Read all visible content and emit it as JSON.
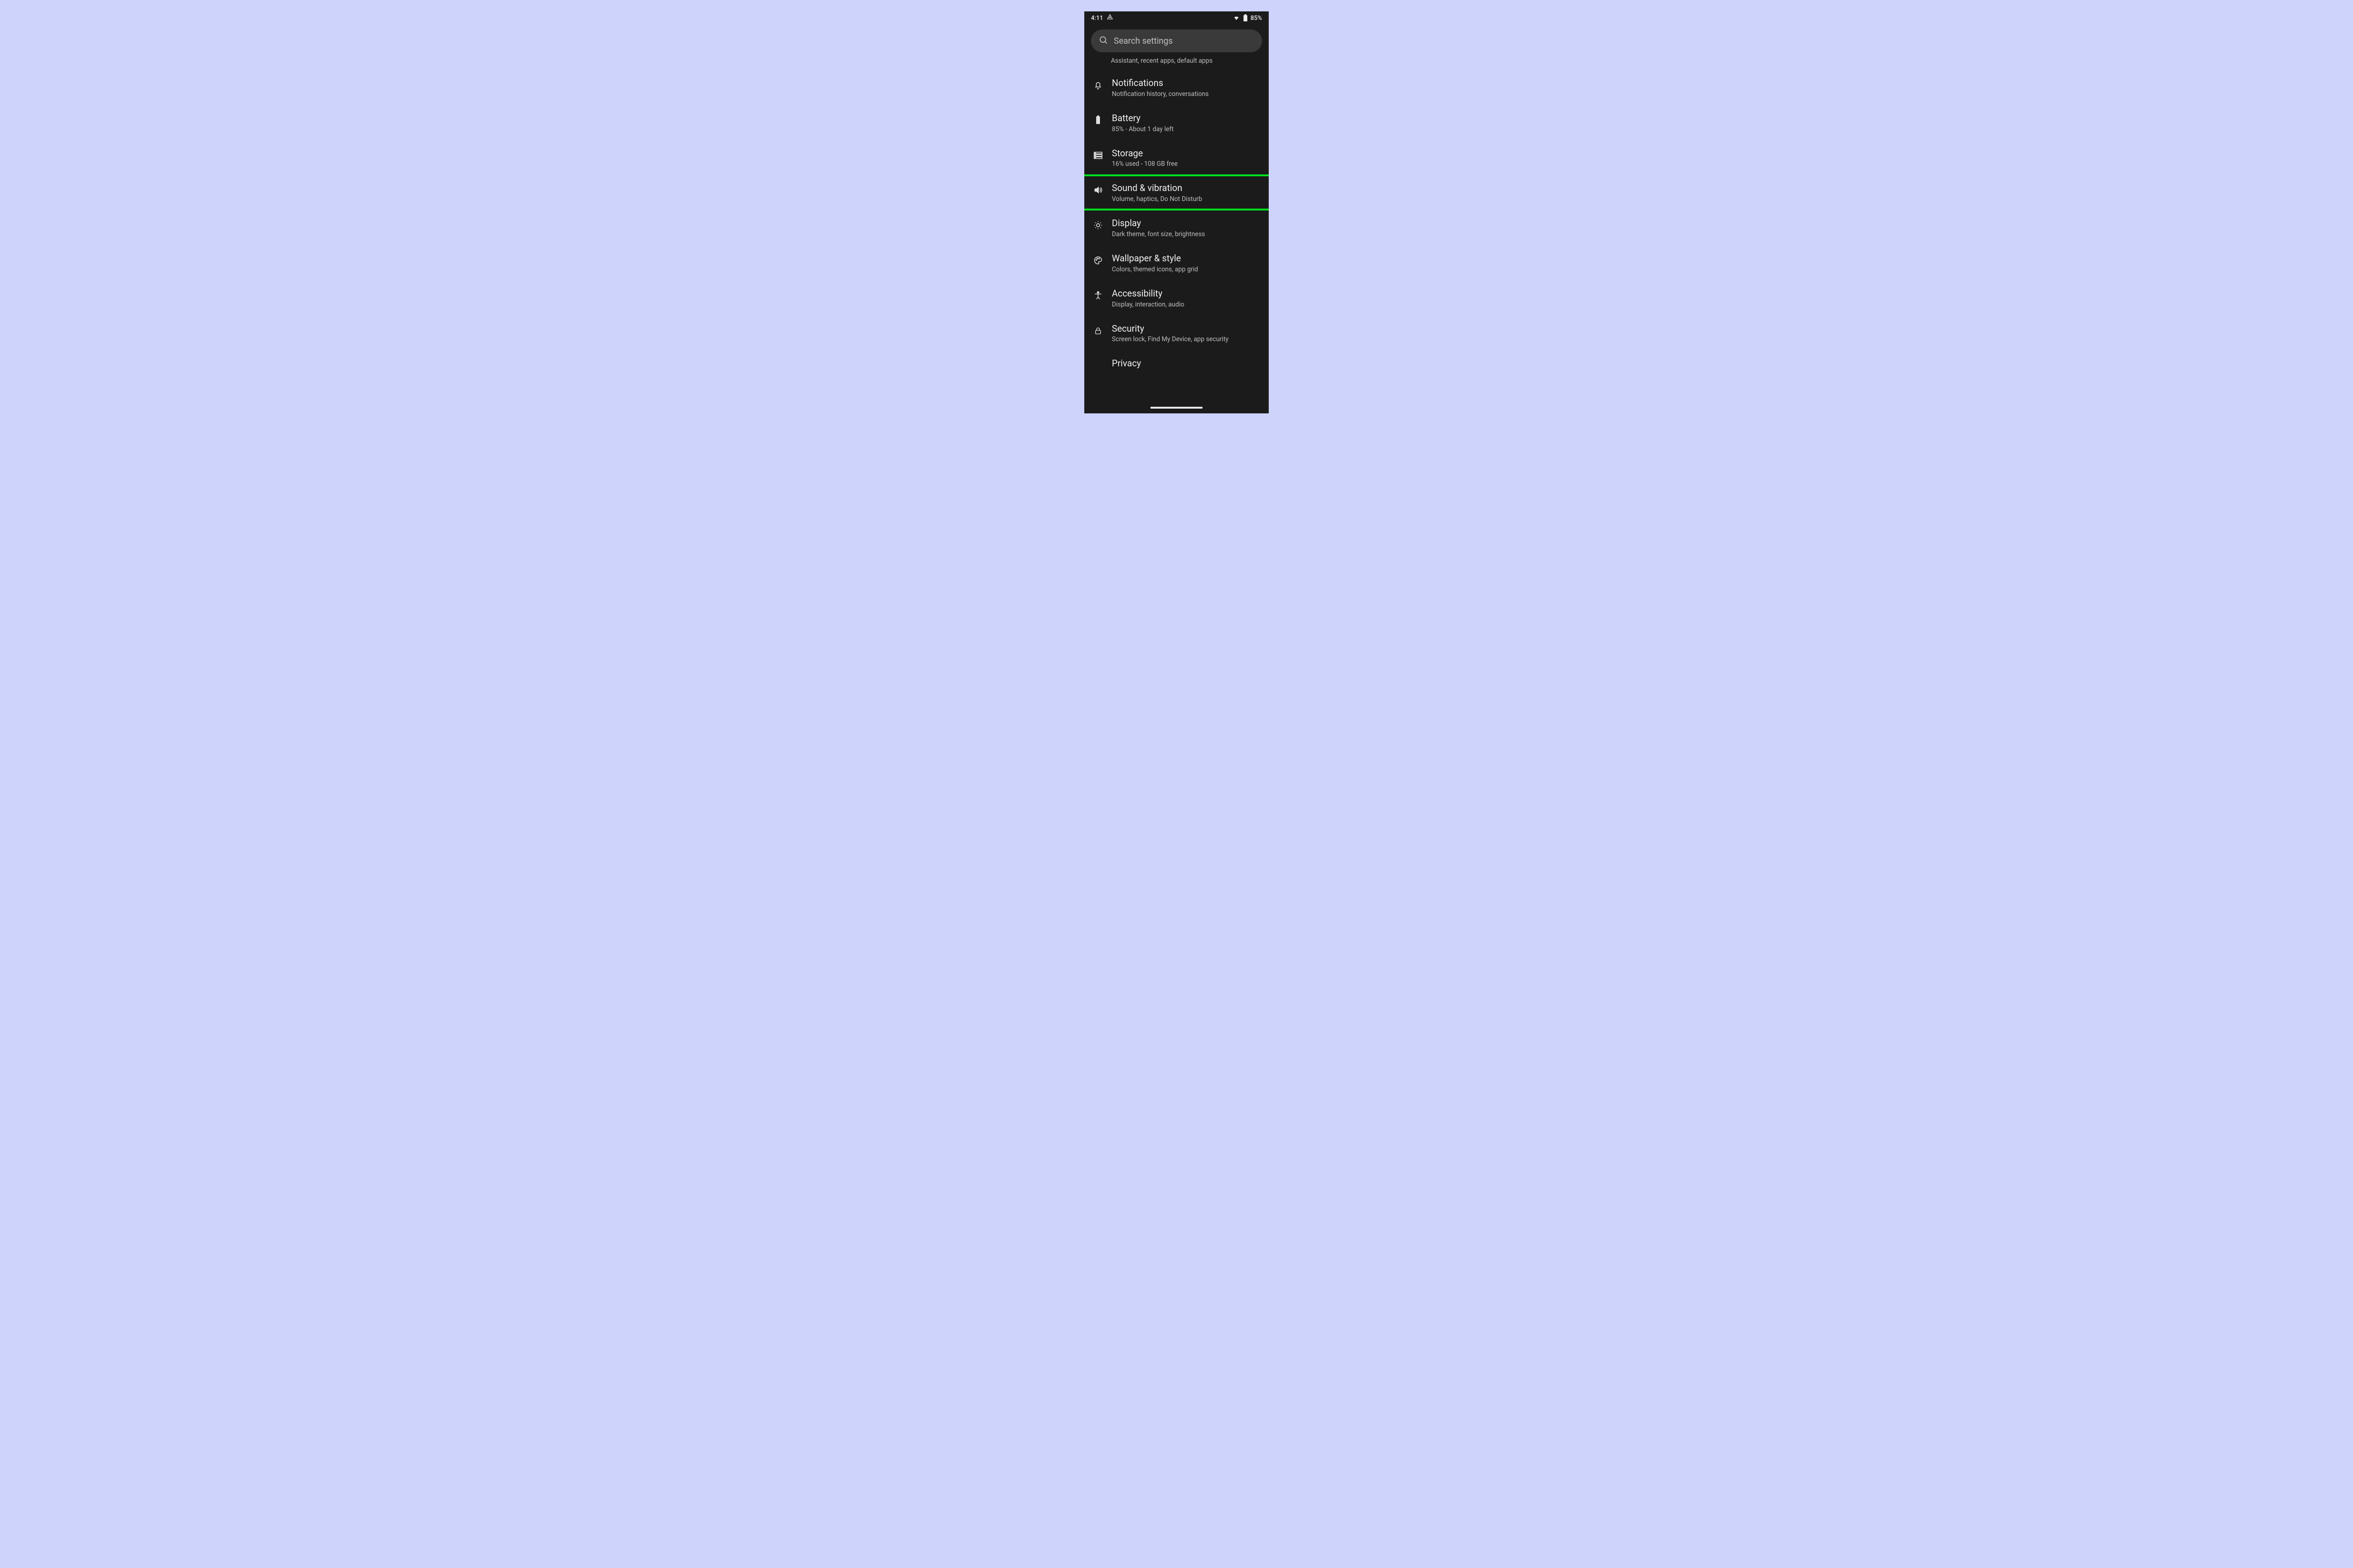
{
  "status": {
    "time": "4:11",
    "battery_text": "85%"
  },
  "search": {
    "placeholder": "Search settings"
  },
  "partial_subtitle": "Assistant, recent apps, default apps",
  "items": [
    {
      "title": "Notifications",
      "sub": "Notification history, conversations"
    },
    {
      "title": "Battery",
      "sub": "85% - About 1 day left"
    },
    {
      "title": "Storage",
      "sub": "16% used - 108 GB free"
    },
    {
      "title": "Sound & vibration",
      "sub": "Volume, haptics, Do Not Disturb"
    },
    {
      "title": "Display",
      "sub": "Dark theme, font size, brightness"
    },
    {
      "title": "Wallpaper & style",
      "sub": "Colors, themed icons, app grid"
    },
    {
      "title": "Accessibility",
      "sub": "Display, interaction, audio"
    },
    {
      "title": "Security",
      "sub": "Screen lock, Find My Device, app security"
    },
    {
      "title": "Privacy",
      "sub": ""
    }
  ],
  "highlight": {
    "target_index": 3,
    "color": "#00e020"
  }
}
